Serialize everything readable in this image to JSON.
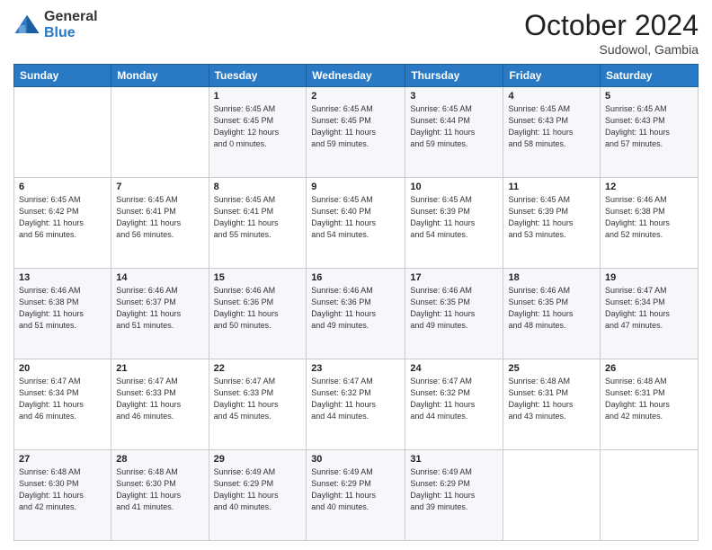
{
  "header": {
    "logo": {
      "general": "General",
      "blue": "Blue"
    },
    "title": "October 2024",
    "subtitle": "Sudowol, Gambia"
  },
  "weekdays": [
    "Sunday",
    "Monday",
    "Tuesday",
    "Wednesday",
    "Thursday",
    "Friday",
    "Saturday"
  ],
  "weeks": [
    [
      {
        "day": "",
        "detail": ""
      },
      {
        "day": "",
        "detail": ""
      },
      {
        "day": "1",
        "detail": "Sunrise: 6:45 AM\nSunset: 6:45 PM\nDaylight: 12 hours\nand 0 minutes."
      },
      {
        "day": "2",
        "detail": "Sunrise: 6:45 AM\nSunset: 6:45 PM\nDaylight: 11 hours\nand 59 minutes."
      },
      {
        "day": "3",
        "detail": "Sunrise: 6:45 AM\nSunset: 6:44 PM\nDaylight: 11 hours\nand 59 minutes."
      },
      {
        "day": "4",
        "detail": "Sunrise: 6:45 AM\nSunset: 6:43 PM\nDaylight: 11 hours\nand 58 minutes."
      },
      {
        "day": "5",
        "detail": "Sunrise: 6:45 AM\nSunset: 6:43 PM\nDaylight: 11 hours\nand 57 minutes."
      }
    ],
    [
      {
        "day": "6",
        "detail": "Sunrise: 6:45 AM\nSunset: 6:42 PM\nDaylight: 11 hours\nand 56 minutes."
      },
      {
        "day": "7",
        "detail": "Sunrise: 6:45 AM\nSunset: 6:41 PM\nDaylight: 11 hours\nand 56 minutes."
      },
      {
        "day": "8",
        "detail": "Sunrise: 6:45 AM\nSunset: 6:41 PM\nDaylight: 11 hours\nand 55 minutes."
      },
      {
        "day": "9",
        "detail": "Sunrise: 6:45 AM\nSunset: 6:40 PM\nDaylight: 11 hours\nand 54 minutes."
      },
      {
        "day": "10",
        "detail": "Sunrise: 6:45 AM\nSunset: 6:39 PM\nDaylight: 11 hours\nand 54 minutes."
      },
      {
        "day": "11",
        "detail": "Sunrise: 6:45 AM\nSunset: 6:39 PM\nDaylight: 11 hours\nand 53 minutes."
      },
      {
        "day": "12",
        "detail": "Sunrise: 6:46 AM\nSunset: 6:38 PM\nDaylight: 11 hours\nand 52 minutes."
      }
    ],
    [
      {
        "day": "13",
        "detail": "Sunrise: 6:46 AM\nSunset: 6:38 PM\nDaylight: 11 hours\nand 51 minutes."
      },
      {
        "day": "14",
        "detail": "Sunrise: 6:46 AM\nSunset: 6:37 PM\nDaylight: 11 hours\nand 51 minutes."
      },
      {
        "day": "15",
        "detail": "Sunrise: 6:46 AM\nSunset: 6:36 PM\nDaylight: 11 hours\nand 50 minutes."
      },
      {
        "day": "16",
        "detail": "Sunrise: 6:46 AM\nSunset: 6:36 PM\nDaylight: 11 hours\nand 49 minutes."
      },
      {
        "day": "17",
        "detail": "Sunrise: 6:46 AM\nSunset: 6:35 PM\nDaylight: 11 hours\nand 49 minutes."
      },
      {
        "day": "18",
        "detail": "Sunrise: 6:46 AM\nSunset: 6:35 PM\nDaylight: 11 hours\nand 48 minutes."
      },
      {
        "day": "19",
        "detail": "Sunrise: 6:47 AM\nSunset: 6:34 PM\nDaylight: 11 hours\nand 47 minutes."
      }
    ],
    [
      {
        "day": "20",
        "detail": "Sunrise: 6:47 AM\nSunset: 6:34 PM\nDaylight: 11 hours\nand 46 minutes."
      },
      {
        "day": "21",
        "detail": "Sunrise: 6:47 AM\nSunset: 6:33 PM\nDaylight: 11 hours\nand 46 minutes."
      },
      {
        "day": "22",
        "detail": "Sunrise: 6:47 AM\nSunset: 6:33 PM\nDaylight: 11 hours\nand 45 minutes."
      },
      {
        "day": "23",
        "detail": "Sunrise: 6:47 AM\nSunset: 6:32 PM\nDaylight: 11 hours\nand 44 minutes."
      },
      {
        "day": "24",
        "detail": "Sunrise: 6:47 AM\nSunset: 6:32 PM\nDaylight: 11 hours\nand 44 minutes."
      },
      {
        "day": "25",
        "detail": "Sunrise: 6:48 AM\nSunset: 6:31 PM\nDaylight: 11 hours\nand 43 minutes."
      },
      {
        "day": "26",
        "detail": "Sunrise: 6:48 AM\nSunset: 6:31 PM\nDaylight: 11 hours\nand 42 minutes."
      }
    ],
    [
      {
        "day": "27",
        "detail": "Sunrise: 6:48 AM\nSunset: 6:30 PM\nDaylight: 11 hours\nand 42 minutes."
      },
      {
        "day": "28",
        "detail": "Sunrise: 6:48 AM\nSunset: 6:30 PM\nDaylight: 11 hours\nand 41 minutes."
      },
      {
        "day": "29",
        "detail": "Sunrise: 6:49 AM\nSunset: 6:29 PM\nDaylight: 11 hours\nand 40 minutes."
      },
      {
        "day": "30",
        "detail": "Sunrise: 6:49 AM\nSunset: 6:29 PM\nDaylight: 11 hours\nand 40 minutes."
      },
      {
        "day": "31",
        "detail": "Sunrise: 6:49 AM\nSunset: 6:29 PM\nDaylight: 11 hours\nand 39 minutes."
      },
      {
        "day": "",
        "detail": ""
      },
      {
        "day": "",
        "detail": ""
      }
    ]
  ]
}
